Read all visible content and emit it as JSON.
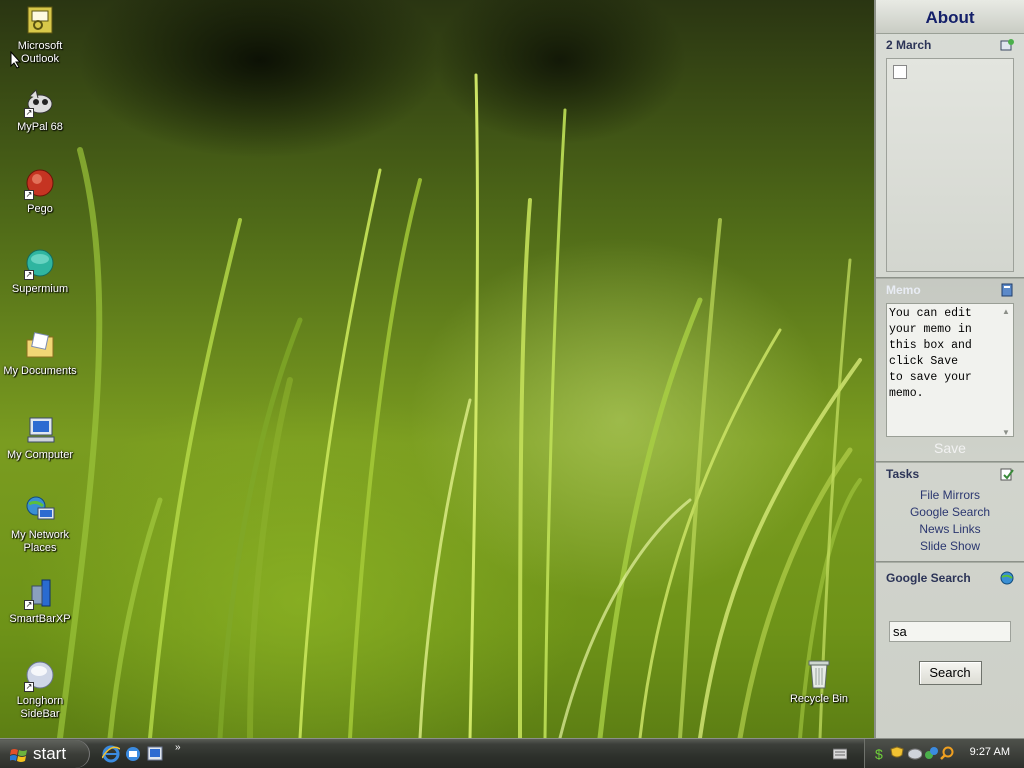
{
  "desktop": {
    "icons": [
      {
        "id": "outlook",
        "label": "Microsoft Outlook",
        "icon": "outlook-icon"
      },
      {
        "id": "mypal",
        "label": "MyPal 68",
        "icon": "mypal-icon"
      },
      {
        "id": "pego",
        "label": "Pego",
        "icon": "pego-icon"
      },
      {
        "id": "supermium",
        "label": "Supermium",
        "icon": "supermium-icon"
      },
      {
        "id": "mydocs",
        "label": "My Documents",
        "icon": "folder-icon"
      },
      {
        "id": "mycomputer",
        "label": "My Computer",
        "icon": "computer-icon"
      },
      {
        "id": "network",
        "label": "My Network Places",
        "icon": "network-icon"
      },
      {
        "id": "smartbar",
        "label": "SmartBarXP",
        "icon": "smartbar-icon"
      },
      {
        "id": "longhorn",
        "label": "Longhorn SideBar",
        "icon": "longhorn-icon"
      },
      {
        "id": "recycle",
        "label": "Recycle Bin",
        "icon": "recycle-bin-icon"
      }
    ]
  },
  "sidebar": {
    "about": "About",
    "slideshow": {
      "title": "2 March"
    },
    "memo": {
      "title": "Memo",
      "text": "You can edit\nyour memo in\nthis box and\nclick Save\nto save your\nmemo.",
      "save": "Save"
    },
    "tasks": {
      "title": "Tasks",
      "items": [
        "File Mirrors",
        "Google Search",
        "News Links",
        "Slide Show"
      ]
    },
    "google_search": {
      "title": "Google Search",
      "query": "sa",
      "button": "Search"
    }
  },
  "taskbar": {
    "start": "start",
    "clock": "9:27 AM",
    "overflow": "»"
  },
  "colors": {
    "sidebar_heading": "#14206a",
    "task_link": "#2b3770"
  }
}
